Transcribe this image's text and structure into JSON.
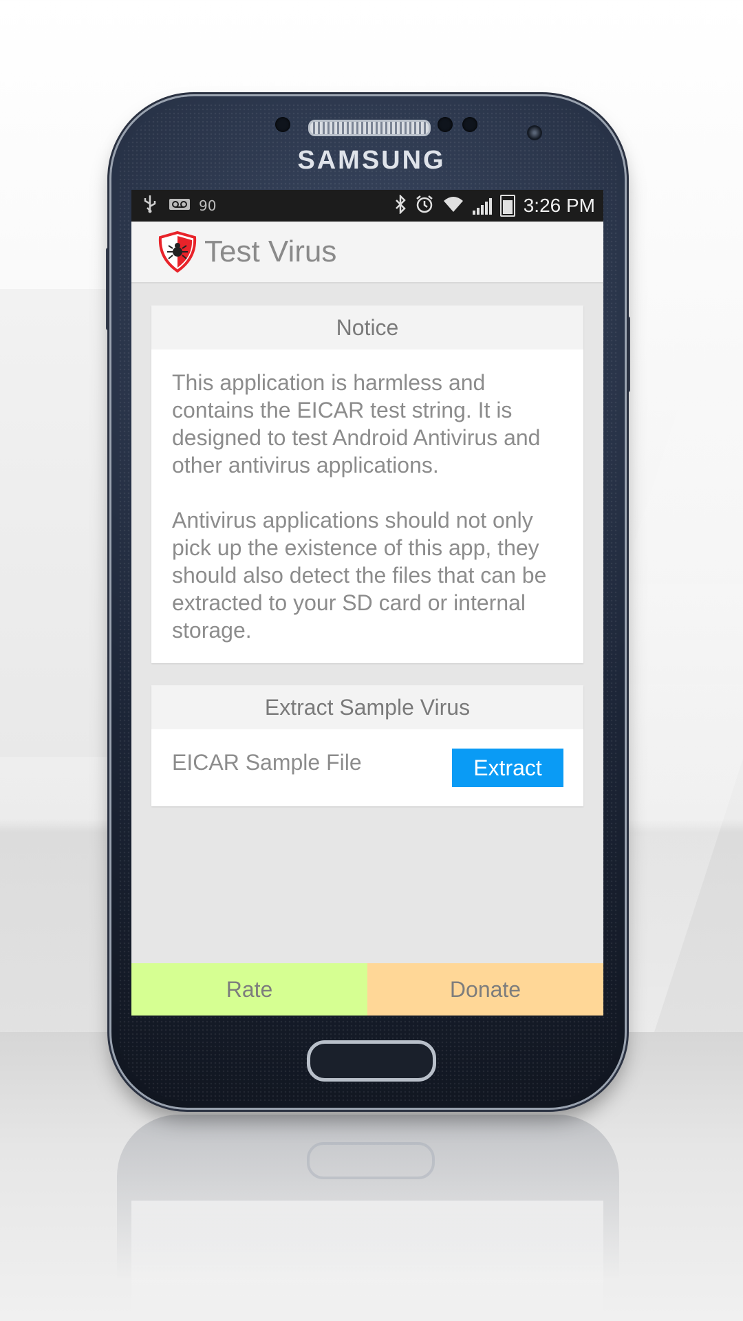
{
  "device": {
    "brand": "SAMSUNG"
  },
  "status_bar": {
    "left_icons": [
      "usb-icon",
      "voicemail-icon"
    ],
    "notification_count": "90",
    "right_icons": [
      "bluetooth-icon",
      "alarm-icon",
      "wifi-icon",
      "signal-icon",
      "battery-charging-icon"
    ],
    "time": "3:26 PM"
  },
  "action_bar": {
    "app_icon": "shield-bug-icon",
    "title": "Test Virus"
  },
  "notice_card": {
    "header": "Notice",
    "paragraph_1": "This application is harmless and contains the EICAR test string. It is designed to test Android Antivirus and other antivirus applications.",
    "paragraph_2": "Antivirus applications should not only pick up the existence of this app, they should also detect the files that can be extracted to your SD card or internal storage."
  },
  "extract_card": {
    "header": "Extract Sample Virus",
    "item_label": "EICAR Sample File",
    "button_label": "Extract"
  },
  "bottom_bar": {
    "rate_label": "Rate",
    "donate_label": "Donate"
  },
  "colors": {
    "extract_button": "#0a9bf5",
    "rate_background": "#d6ff92",
    "donate_background": "#ffd797",
    "logo_red": "#e8232a"
  }
}
